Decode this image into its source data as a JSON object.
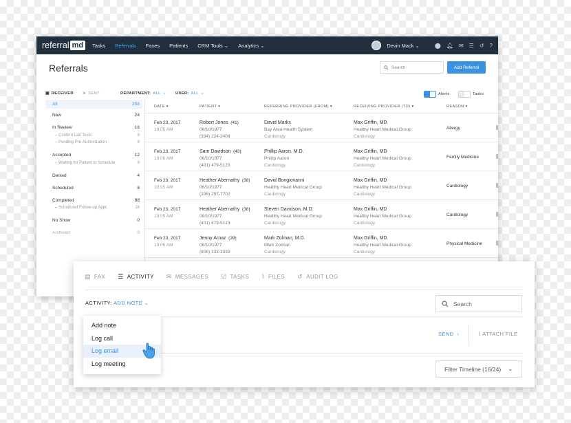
{
  "app": {
    "logo_text": "referral",
    "logo_badge": "md",
    "nav": [
      "Tasks",
      "Referrals",
      "Faxes",
      "Patients",
      "CRM Tools ⌄",
      "Analytics ⌄"
    ],
    "active_nav": "Referrals",
    "user_name": "Devin Mack ⌄",
    "topbar_icons": [
      "pin-icon",
      "bell-icon",
      "mail-icon",
      "list-icon",
      "refresh-icon",
      "help-icon"
    ]
  },
  "page": {
    "title": "Referrals",
    "search_placeholder": "Search",
    "add_button": "Add Referral"
  },
  "filters": {
    "received": "RECEIVED",
    "sent": "SENT",
    "department_label": "DEPARTMENT:",
    "department_value": "ALL",
    "user_label": "USER:",
    "user_value": "ALL",
    "alerts_label": "Alerts",
    "alerts_on": true,
    "tasks_label": "Tasks",
    "tasks_on": false
  },
  "sidebar": [
    {
      "label": "All",
      "count": "256"
    },
    {
      "label": "New",
      "count": "24"
    },
    {
      "label": "In Review",
      "count": "16"
    },
    {
      "label": "– Confirm Lab Tests",
      "count": "8",
      "sub": true
    },
    {
      "label": "– Pending Pre-Authorization",
      "count": "8",
      "sub": true
    },
    {
      "label": "Accepted",
      "count": "12"
    },
    {
      "label": "– Waiting for Patient to Schedule",
      "count": "8",
      "sub": true
    },
    {
      "label": "Denied",
      "count": "4"
    },
    {
      "label": "Scheduled",
      "count": "8"
    },
    {
      "label": "Completed",
      "count": "88"
    },
    {
      "label": "– Scheduled Follow-up Appt.",
      "count": "16",
      "sub": true
    },
    {
      "label": "No Show",
      "count": "0"
    },
    {
      "label": "Archived",
      "count": "0"
    }
  ],
  "table": {
    "headers": [
      "DATE ▾",
      "PATIENT ▾",
      "REFERRING PROVIDER (FROM) ▾",
      "RECEIVING PROVIDER (TO) ▾",
      "REASON ▾"
    ],
    "rows": [
      {
        "date": "Feb 23, 2017",
        "time": "10:05 AM",
        "patient": "Robert Jones",
        "age": "(41)",
        "dob": "06/10/1977",
        "phone": "(334) 224-2408",
        "ref_name": "David Marks",
        "ref_org": "Bay Area Health System",
        "ref_spec": "Cardiology",
        "rec_name": "Max Griffin, MD",
        "rec_org": "Healthy Heart Medical Group",
        "rec_spec": "Cardiology",
        "reason": "Allergy"
      },
      {
        "date": "Feb 23, 2017",
        "time": "10:05 AM",
        "patient": "Sam Davidson",
        "age": "(43)",
        "dob": "06/10/1977",
        "phone": "(401) 479-5123",
        "ref_name": "Phillip Aaron, M.D.",
        "ref_org": "Phillip Aaron",
        "ref_spec": "Cardiology",
        "rec_name": "Max Griffin, MD",
        "rec_org": "Healthy Heart Medical Group",
        "rec_spec": "Cardiology",
        "reason": "Family Medicine"
      },
      {
        "date": "Feb 23, 2017",
        "time": "10:05 AM",
        "patient": "Heather Abernathy",
        "age": "(38)",
        "dob": "06/10/1977",
        "phone": "(336) 257-7702",
        "ref_name": "David Bongiovanni",
        "ref_org": "Healthy Heart Medical Group",
        "ref_spec": "Cardiology",
        "rec_name": "Max Griffin, MD",
        "rec_org": "Healthy Heart Medical Group",
        "rec_spec": "Cardiology",
        "reason": "Cardiology"
      },
      {
        "date": "Feb 23, 2017",
        "time": "10:05 AM",
        "patient": "Heather Abernathy",
        "age": "(38)",
        "dob": "06/10/1977",
        "phone": "(401) 479-5123",
        "ref_name": "Steven Davidson, M.D.",
        "ref_org": "Healthy Heart Medical Group",
        "ref_spec": "Cardiology",
        "rec_name": "Max Griffin, MD",
        "rec_org": "Healthy Heart Medical Group",
        "rec_spec": "Cardiology",
        "reason": "Cardiology"
      },
      {
        "date": "Feb 23, 2017",
        "time": "10:05 AM",
        "patient": "Jenny Arnaz",
        "age": "(39)",
        "dob": "06/10/1977",
        "phone": "(806) 333-3333",
        "ref_name": "Mark Zolman, M.D.",
        "ref_org": "Mark Zolman",
        "ref_spec": "Cardiology",
        "rec_name": "Max Griffin, MD",
        "rec_org": "Healthy Heart Medical Group",
        "rec_spec": "Cardiology",
        "reason": "Physical Medicine"
      }
    ]
  },
  "panel": {
    "tabs": [
      {
        "icon": "fax-icon",
        "label": "FAX"
      },
      {
        "icon": "list-icon",
        "label": "ACTIVITY"
      },
      {
        "icon": "envelope-icon",
        "label": "MESSAGES"
      },
      {
        "icon": "check-icon",
        "label": "TASKS"
      },
      {
        "icon": "paperclip-icon",
        "label": "FILES"
      },
      {
        "icon": "history-icon",
        "label": "AUDIT LOG"
      }
    ],
    "active_tab": "ACTIVITY",
    "activity_label": "ACTIVITY:",
    "activity_value": "ADD NOTE",
    "search_placeholder": "Search",
    "send": "SEND",
    "attach": "ATTACH FILE",
    "filter_timeline": "Filter Timeline (16/24)"
  },
  "dropdown": {
    "items": [
      "Add note",
      "Log call",
      "Log email",
      "Log meeting"
    ],
    "highlighted": "Log email"
  },
  "colors": {
    "topbar": "#1f2f3e",
    "accent": "#3a92e0"
  }
}
